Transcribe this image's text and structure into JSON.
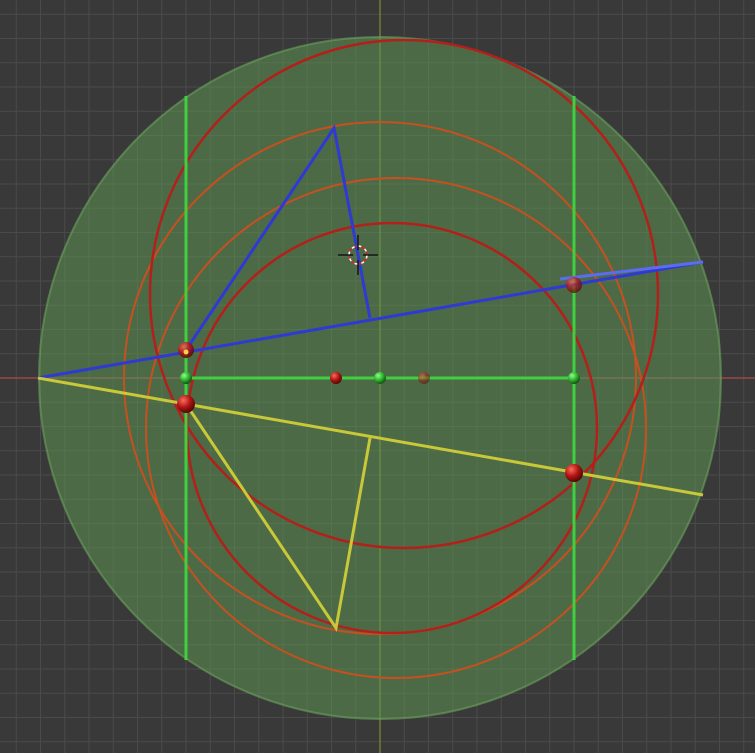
{
  "viewport": {
    "background": "#393939",
    "grid_color": "#4a4a4a",
    "axis_x_color": "#b04a4a",
    "axis_y_color": "#7a8f2e"
  },
  "colors": {
    "sphere_fill": "#5f9454",
    "sphere_edge": "#6aa35e",
    "circle_red": "#b3201a",
    "circle_orange": "#c6501f",
    "line_green": "#3fcf3f",
    "line_blue": "#2f3ad2",
    "line_blue_light": "#5b6cf0",
    "line_yellow": "#c8c838",
    "point_red": "#b01515",
    "point_green": "#2fb52f"
  },
  "scene": {
    "cursor": "3d-cursor-icon",
    "objects": [
      "sphere",
      "red-circle-top",
      "orange-circle-upper",
      "orange-circle-lower",
      "green-vertical-left",
      "green-vertical-right",
      "green-horizontal",
      "blue-line",
      "blue-triangle",
      "yellow-line",
      "yellow-triangle"
    ]
  }
}
